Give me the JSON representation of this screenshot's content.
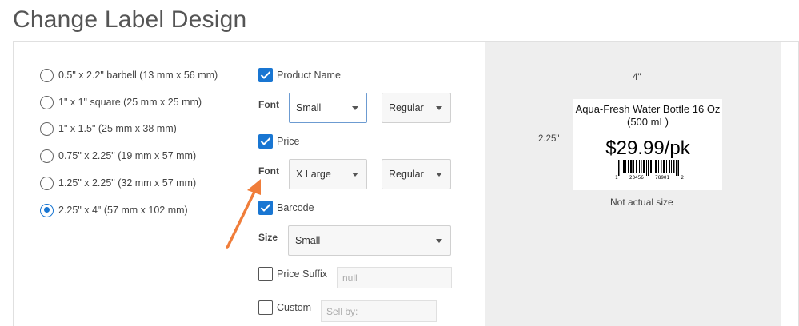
{
  "page_title": "Change Label Design",
  "label_sizes": [
    {
      "label": "0.5\" x 2.2\" barbell (13 mm x 56 mm)",
      "selected": false
    },
    {
      "label": "1\" x 1\" square (25 mm x 25 mm)",
      "selected": false
    },
    {
      "label": "1\" x 1.5\" (25 mm x 38 mm)",
      "selected": false
    },
    {
      "label": "0.75\" x 2.25\" (19 mm x 57 mm)",
      "selected": false
    },
    {
      "label": "1.25\" x 2.25\" (32 mm x 57 mm)",
      "selected": false
    },
    {
      "label": "2.25\" x 4\" (57 mm x 102 mm)",
      "selected": true
    }
  ],
  "options": {
    "product_name": {
      "label": "Product Name",
      "checked": true,
      "font_label": "Font",
      "size": "Small",
      "weight": "Regular"
    },
    "price": {
      "label": "Price",
      "checked": true,
      "font_label": "Font",
      "size": "X Large",
      "weight": "Regular"
    },
    "barcode": {
      "label": "Barcode",
      "checked": true,
      "size_label": "Size",
      "size": "Small"
    },
    "price_suffix": {
      "label": "Price Suffix",
      "checked": false,
      "value": "null"
    },
    "custom": {
      "label": "Custom",
      "checked": false,
      "placeholder": "Sell by:"
    }
  },
  "preview": {
    "width_label": "4\"",
    "height_label": "2.25\"",
    "product_name_line1": "Aqua-Fresh Water Bottle 16 Oz",
    "product_name_line2": "(500 mL)",
    "price": "$29.99/pk",
    "barcode_digits": [
      "1",
      "23456",
      "78901",
      "2"
    ],
    "note": "Not actual size"
  },
  "colors": {
    "accent": "#1976d2",
    "arrow": "#f07d3a",
    "preview_bg": "#eeeeee"
  }
}
